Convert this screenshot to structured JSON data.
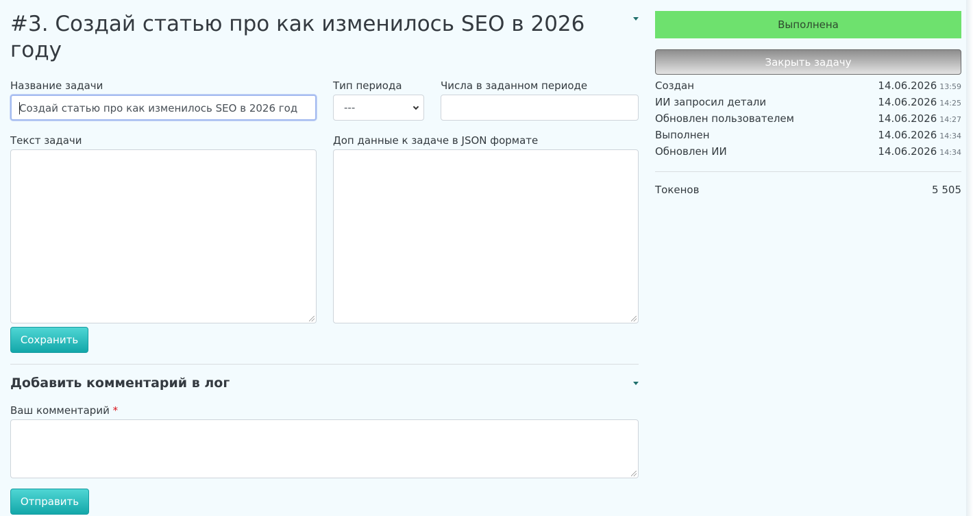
{
  "task": {
    "title": "#3. Создай статью про как изменилось SEO в 2026 году",
    "form": {
      "name_label": "Название задачи",
      "name_value": "Создай статью про как изменилось SEO в 2026 год",
      "period_type_label": "Тип периода",
      "period_type_value": "---",
      "period_numbers_label": "Числа в заданном периоде",
      "period_numbers_value": "",
      "text_label": "Текст задачи",
      "text_value": "",
      "json_label": "Доп данные к задаче в JSON формате",
      "json_value": "",
      "save_label": "Сохранить"
    }
  },
  "comment": {
    "section_title": "Добавить комментарий в лог",
    "field_label": "Ваш комментарий",
    "required_mark": "*",
    "value": "",
    "send_label": "Отправить"
  },
  "sidebar": {
    "status_label": "Выполнена",
    "status_color": "#6ee16e",
    "close_label": "Закрыть задачу",
    "history": [
      {
        "name": "Создан",
        "date": "14.06.2026",
        "time": "13:59"
      },
      {
        "name": "ИИ запросил детали",
        "date": "14.06.2026",
        "time": "14:25"
      },
      {
        "name": "Обновлен пользователем",
        "date": "14.06.2026",
        "time": "14:27"
      },
      {
        "name": "Выполнен",
        "date": "14.06.2026",
        "time": "14:34"
      },
      {
        "name": "Обновлен ИИ",
        "date": "14.06.2026",
        "time": "14:34"
      }
    ],
    "tokens_label": "Токенов",
    "tokens_value": "5 505"
  },
  "colors": {
    "accent_teal": "#13a7a9",
    "background": "#f3fbfe"
  },
  "icons": {
    "collapse_task": "caret-down-icon",
    "collapse_comment": "caret-down-icon",
    "select_chevron": "chevron-down-icon"
  }
}
